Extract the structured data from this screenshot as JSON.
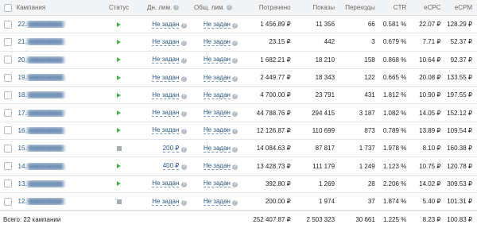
{
  "header": {
    "campaign": "Кампания",
    "status": "Статус",
    "daily_limit": "Дн. лим.",
    "total_limit": "Общ. лим.",
    "spent": "Потрачено",
    "impressions": "Показы",
    "clicks": "Переходы",
    "ctr": "CTR",
    "ecpc": "eCPC",
    "ecpm": "eCPM"
  },
  "rows": [
    {
      "num": "22.",
      "status": "running",
      "status_icon": "play-icon",
      "daily": "Не задан",
      "total": "Не задан",
      "spent": "1 456.89 ₽",
      "impressions": "11 356",
      "clicks": "66",
      "ctr": "0.581 %",
      "ecpc": "22.07 ₽",
      "ecpm": "128.29 ₽"
    },
    {
      "num": "21.",
      "status": "running",
      "status_icon": "play-icon",
      "daily": "Не задан",
      "total": "Не задан",
      "spent": "23.15 ₽",
      "impressions": "442",
      "clicks": "3",
      "ctr": "0.679 %",
      "ecpc": "7.71 ₽",
      "ecpm": "52.37 ₽"
    },
    {
      "num": "20.",
      "status": "running",
      "status_icon": "play-icon",
      "daily": "Не задан",
      "total": "Не задан",
      "spent": "1 682.21 ₽",
      "impressions": "18 210",
      "clicks": "158",
      "ctr": "0.868 %",
      "ecpc": "10.64 ₽",
      "ecpm": "92.37 ₽"
    },
    {
      "num": "19.",
      "status": "running",
      "status_icon": "play-icon",
      "daily": "Не задан",
      "total": "Не задан",
      "spent": "2 449.77 ₽",
      "impressions": "18 343",
      "clicks": "122",
      "ctr": "0.665 %",
      "ecpc": "20.08 ₽",
      "ecpm": "133.55 ₽"
    },
    {
      "num": "18.",
      "status": "running",
      "status_icon": "play-icon",
      "daily": "Не задан",
      "total": "Не задан",
      "spent": "4 700.00 ₽",
      "impressions": "23 791",
      "clicks": "431",
      "ctr": "1.812 %",
      "ecpc": "10.90 ₽",
      "ecpm": "197.55 ₽"
    },
    {
      "num": "17.",
      "status": "running",
      "status_icon": "play-icon",
      "daily": "Не задан",
      "total": "Не задан",
      "spent": "44 788.76 ₽",
      "impressions": "294 415",
      "clicks": "3 187",
      "ctr": "1.082 %",
      "ecpc": "14.05 ₽",
      "ecpm": "152.12 ₽"
    },
    {
      "num": "16.",
      "status": "running",
      "status_icon": "play-icon",
      "daily": "Не задан",
      "total": "Не задан",
      "spent": "12 126.87 ₽",
      "impressions": "110 699",
      "clicks": "873",
      "ctr": "0.789 %",
      "ecpc": "13.89 ₽",
      "ecpm": "109.54 ₽"
    },
    {
      "num": "15.",
      "status": "stopped",
      "status_icon": "stop-icon",
      "daily": "200 ₽",
      "total": "Не задан",
      "spent": "14 084.63 ₽",
      "impressions": "87 817",
      "clicks": "1 737",
      "ctr": "1.978 %",
      "ecpc": "8.10 ₽",
      "ecpm": "160.38 ₽"
    },
    {
      "num": "14.",
      "status": "running",
      "status_icon": "play-icon",
      "daily": "400 ₽",
      "total": "Не задан",
      "spent": "13 428.73 ₽",
      "impressions": "111 179",
      "clicks": "1 249",
      "ctr": "1.123 %",
      "ecpc": "10.75 ₽",
      "ecpm": "120.78 ₽"
    },
    {
      "num": "13.",
      "status": "running",
      "status_icon": "play-icon",
      "daily": "Не задан",
      "total": "Не задан",
      "spent": "392.80 ₽",
      "impressions": "1 269",
      "clicks": "28",
      "ctr": "2.206 %",
      "ecpc": "14.02 ₽",
      "ecpm": "309.53 ₽"
    },
    {
      "num": "12.",
      "status": "stopped",
      "status_icon": "stop-icon",
      "daily": "Не задан",
      "total": "Не задан",
      "spent": "200.00 ₽",
      "impressions": "1 974",
      "clicks": "37",
      "ctr": "1.874 %",
      "ecpc": "5.40 ₽",
      "ecpm": "101.31 ₽"
    }
  ],
  "footer": {
    "label": "Всего: 22 кампании",
    "spent": "252 407.87 ₽",
    "impressions": "2 503 323",
    "clicks": "30 661",
    "ctr": "1.225 %",
    "ecpc": "8.23 ₽",
    "ecpm": "100.83 ₽"
  },
  "colors": {
    "link": "#2a5885",
    "play": "#4bb34b",
    "stop": "#a8adb4"
  }
}
